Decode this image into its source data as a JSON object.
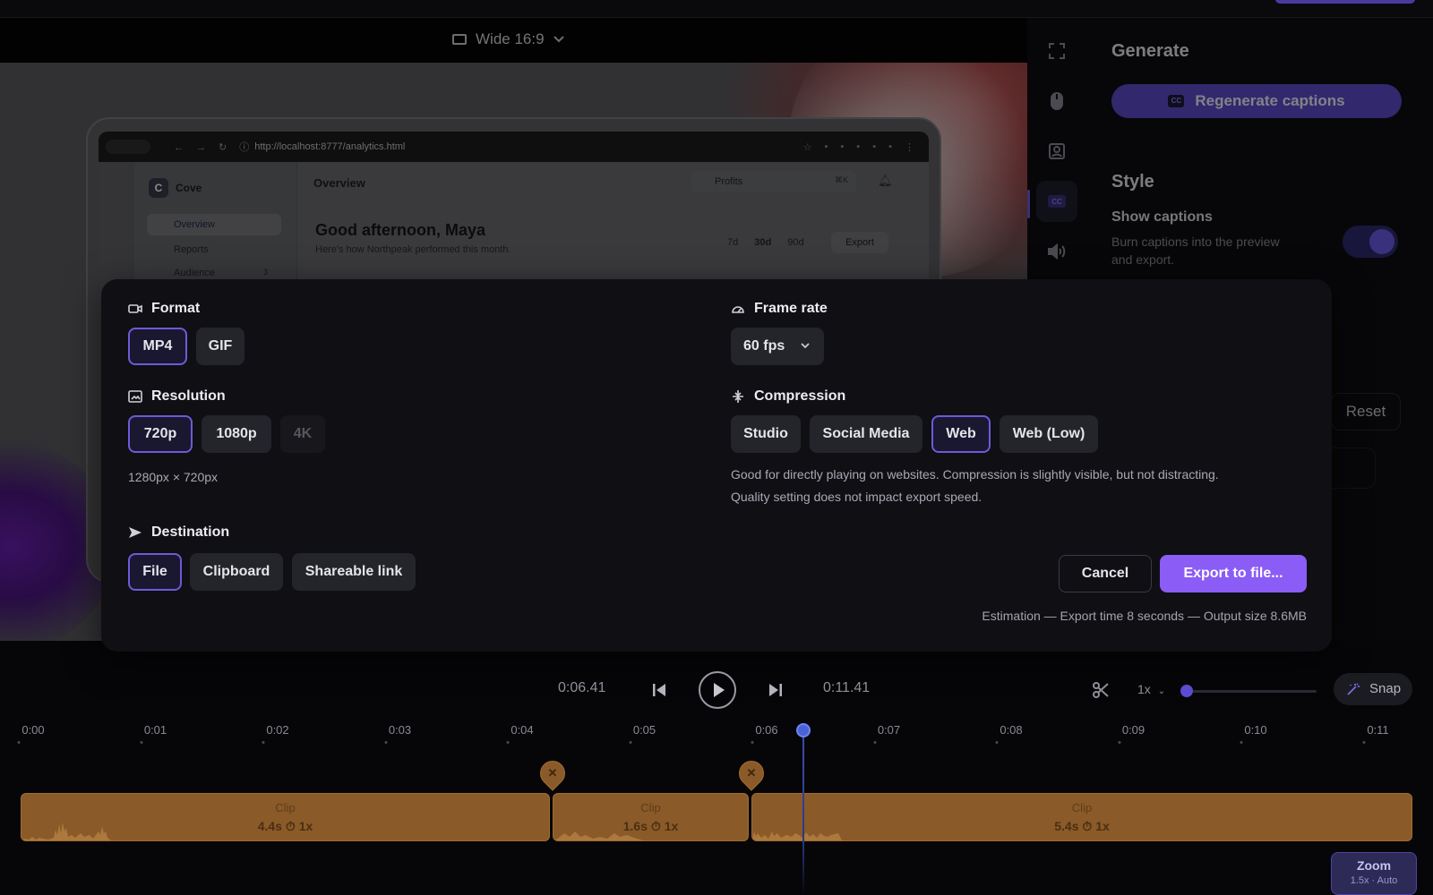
{
  "editor": {
    "aspect_label": "Wide 16:9"
  },
  "preview": {
    "url": "http://localhost:8777/analytics.html",
    "brand_initial": "C",
    "brand": "Cove",
    "nav": [
      "Overview",
      "Reports",
      "Audience"
    ],
    "audience_badge": "3",
    "page_title": "Overview",
    "search_value": "Profits",
    "search_shortcut": "⌘K",
    "greeting": "Good afternoon, Maya",
    "subtitle": "Here's how Northpeak performed this month.",
    "ranges": [
      "7d",
      "30d",
      "90d"
    ],
    "export_label": "Export"
  },
  "side_panel": {
    "generate_title": "Generate",
    "regenerate_label": "Regenerate captions",
    "style_title": "Style",
    "show_captions_label": "Show captions",
    "show_captions_desc_1": "Burn captions into the preview",
    "show_captions_desc_2": "and export.",
    "show_captions_on": true,
    "reset_label": "Reset",
    "rail_icons": [
      "fullscreen-icon",
      "mouse-icon",
      "user-card-icon",
      "captions-icon",
      "speaker-icon"
    ],
    "active_rail": "captions-icon"
  },
  "export_modal": {
    "format": {
      "title": "Format",
      "options": [
        "MP4",
        "GIF"
      ],
      "selected": "MP4"
    },
    "frame_rate": {
      "title": "Frame rate",
      "value": "60 fps"
    },
    "resolution": {
      "title": "Resolution",
      "options": [
        "720p",
        "1080p",
        "4K"
      ],
      "selected": "720p",
      "disabled": "4K",
      "dimensions": "1280px × 720px"
    },
    "compression": {
      "title": "Compression",
      "options": [
        "Studio",
        "Social Media",
        "Web",
        "Web (Low)"
      ],
      "selected": "Web",
      "desc_1": "Good for directly playing on websites. Compression is slightly visible, but not distracting.",
      "desc_2": "Quality setting does not impact export speed."
    },
    "destination": {
      "title": "Destination",
      "options": [
        "File",
        "Clipboard",
        "Shareable link"
      ],
      "selected": "File"
    },
    "cancel_label": "Cancel",
    "export_label": "Export to file...",
    "estimate": "Estimation — Export time 8 seconds — Output size 8.6MB"
  },
  "transport": {
    "current_time": "0:06.41",
    "total_time": "0:11.41",
    "speed": "1x",
    "zoom_level": 0,
    "snap_label": "Snap"
  },
  "timeline": {
    "ticks": [
      "0:00",
      "0:01",
      "0:02",
      "0:03",
      "0:04",
      "0:05",
      "0:06",
      "0:07",
      "0:08",
      "0:09",
      "0:10",
      "0:11"
    ],
    "clips": [
      {
        "title": "Clip",
        "duration": "4.4s",
        "speed": "1x"
      },
      {
        "title": "Clip",
        "duration": "1.6s",
        "speed": "1x"
      },
      {
        "title": "Clip",
        "duration": "5.4s",
        "speed": "1x"
      }
    ],
    "cut_marker_symbol": "✕",
    "zoom_title": "Zoom",
    "zoom_detail": "1.5x · Auto"
  },
  "colors": {
    "accent": "#8b5cf6",
    "accent_dark": "#5d4ac9",
    "clip": "#8a5a28",
    "playhead": "#4a62d8"
  }
}
